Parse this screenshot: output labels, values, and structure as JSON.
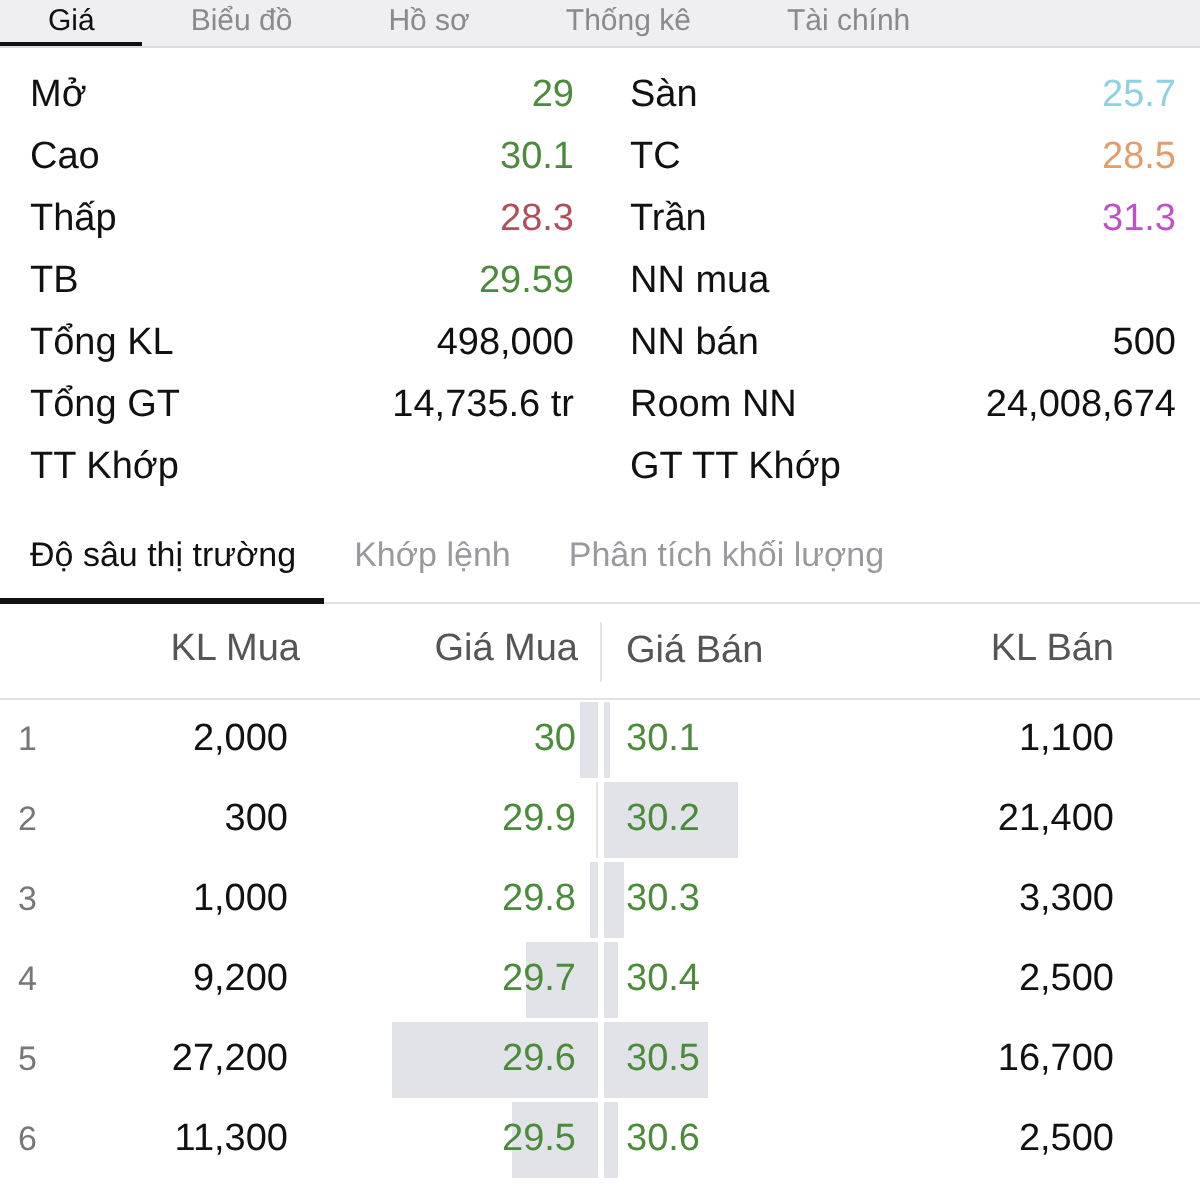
{
  "tabs": [
    {
      "label": "Giá",
      "selected": true
    },
    {
      "label": "Biểu đồ",
      "selected": false
    },
    {
      "label": "Hồ sơ",
      "selected": false
    },
    {
      "label": "Thống kê",
      "selected": false
    },
    {
      "label": "Tài chính",
      "selected": false
    }
  ],
  "stats": [
    {
      "label": "Mở",
      "value": "29",
      "color": "#4b8b3b"
    },
    {
      "label": "Sàn",
      "value": "25.7",
      "color": "#8fd0e2"
    },
    {
      "label": "Cao",
      "value": "30.1",
      "color": "#4b8b3b"
    },
    {
      "label": "TC",
      "value": "28.5",
      "color": "#e39c6a"
    },
    {
      "label": "Thấp",
      "value": "28.3",
      "color": "#b44d5c"
    },
    {
      "label": "Trần",
      "value": "31.3",
      "color": "#c250c9"
    },
    {
      "label": "TB",
      "value": "29.59",
      "color": "#4b8b3b"
    },
    {
      "label": "NN mua"
    },
    {
      "label": "Tổng KL",
      "value": "498,000"
    },
    {
      "label": "NN bán",
      "value": "500"
    },
    {
      "label": "Tổng GT",
      "value": "14,735.6 tr"
    },
    {
      "label": "Room NN",
      "value": "24,008,674"
    },
    {
      "label": "TT Khớp"
    },
    {
      "label": "GT TT Khớp"
    }
  ],
  "subtabs": [
    {
      "label": "Độ sâu thị trường",
      "selected": true
    },
    {
      "label": "Khớp lệnh",
      "selected": false
    },
    {
      "label": "Phân tích khối lượng",
      "selected": false
    }
  ],
  "order_book": {
    "columns": [
      "KL Mua",
      "Giá Mua",
      "Giá Bán",
      "KL Bán"
    ],
    "rows": [
      {
        "index": "1",
        "bid": {
          "volume": "2,000",
          "price": "30",
          "level": 0.06
        },
        "ask": {
          "price": "30.1",
          "volume": "1,100",
          "level": 0.02
        }
      },
      {
        "index": "2",
        "bid": {
          "volume": "300",
          "price": "29.9",
          "level": 0.01
        },
        "ask": {
          "price": "30.2",
          "volume": "21,400",
          "level": 0.45
        }
      },
      {
        "index": "3",
        "bid": {
          "volume": "1,000",
          "price": "29.8",
          "level": 0.03
        },
        "ask": {
          "price": "30.3",
          "volume": "3,300",
          "level": 0.07
        }
      },
      {
        "index": "4",
        "bid": {
          "volume": "9,200",
          "price": "29.7",
          "level": 0.24
        },
        "ask": {
          "price": "30.4",
          "volume": "2,500",
          "level": 0.05
        }
      },
      {
        "index": "5",
        "bid": {
          "volume": "27,200",
          "price": "29.6",
          "level": 0.69
        },
        "ask": {
          "price": "30.5",
          "volume": "16,700",
          "level": 0.35
        }
      },
      {
        "index": "6",
        "bid": {
          "volume": "11,300",
          "price": "29.5",
          "level": 0.29
        },
        "ask": {
          "price": "30.6",
          "volume": "2,500",
          "level": 0.05
        }
      }
    ]
  }
}
